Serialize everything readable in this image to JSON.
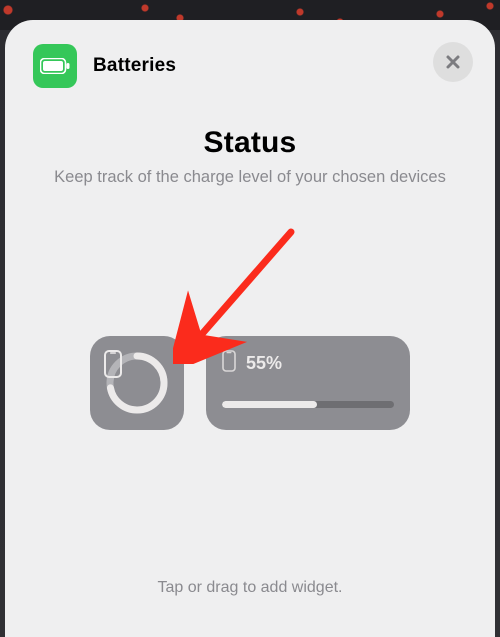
{
  "header": {
    "app_name": "Batteries"
  },
  "title_block": {
    "title": "Status",
    "subtitle": "Keep track of the charge level of your chosen devices"
  },
  "widgets": {
    "small": {
      "ring_percent": 72
    },
    "wide": {
      "percent_label": "55%",
      "percent_value": 55
    }
  },
  "hint": "Tap or drag to add widget.",
  "colors": {
    "accent_green": "#35c759",
    "sheet_bg": "#efeff0",
    "widget_gray": "#8d8d92",
    "arrow_red": "#fb2b1c"
  }
}
